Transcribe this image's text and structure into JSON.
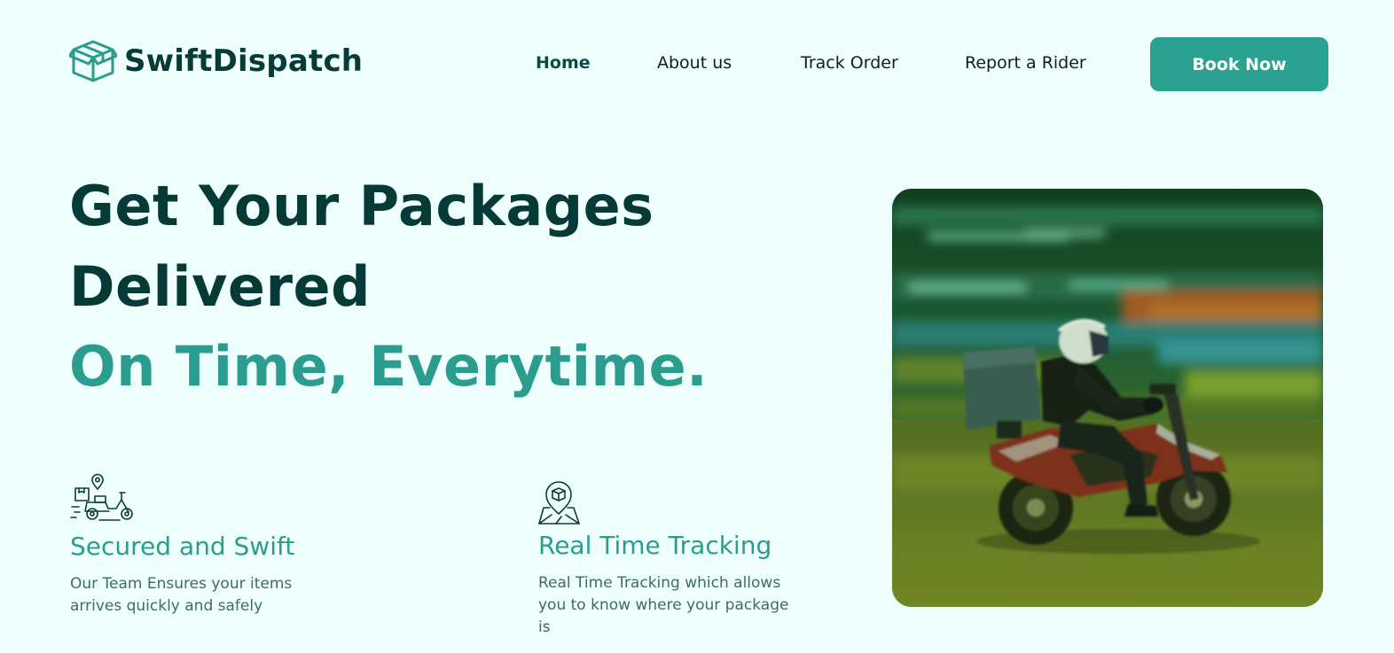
{
  "brand": {
    "name": "SwiftDispatch",
    "icon": "box-icon"
  },
  "nav": {
    "items": [
      {
        "label": "Home",
        "active": true
      },
      {
        "label": "About us",
        "active": false
      },
      {
        "label": "Track Order",
        "active": false
      },
      {
        "label": "Report a Rider",
        "active": false
      }
    ],
    "cta_label": "Book Now"
  },
  "hero": {
    "line1": "Get Your Packages",
    "line2": "Delivered",
    "line3": "On Time, Everytime.",
    "image": "delivery-rider-on-scooter"
  },
  "features": [
    {
      "icon": "scooter-delivery-icon",
      "title": "Secured and Swift",
      "description": "Our Team Ensures your items arrives quickly and safely"
    },
    {
      "icon": "package-location-icon",
      "title": "Real Time Tracking",
      "description": "Real Time Tracking which allows you to know where your package is"
    }
  ],
  "colors": {
    "background": "#effffd",
    "accent": "#2a9d8f",
    "dark": "#063a36",
    "button": "#2ba18f"
  }
}
